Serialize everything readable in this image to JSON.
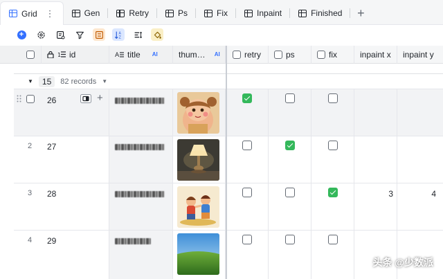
{
  "tabs": [
    {
      "label": "Grid",
      "active": true,
      "close": "⋮"
    },
    {
      "label": "Gen"
    },
    {
      "label": "Retry"
    },
    {
      "label": "Ps"
    },
    {
      "label": "Fix"
    },
    {
      "label": "Inpaint"
    },
    {
      "label": "Finished"
    }
  ],
  "tab_add": "+",
  "toolbar": {
    "icons": [
      "plus-circle-icon",
      "gear-icon",
      "form-icon",
      "filter-icon",
      "group-icon",
      "sort-icon",
      "row-height-icon",
      "fill-color-icon"
    ]
  },
  "columns": {
    "id": "id",
    "title": "title",
    "title_ai": "AI",
    "thumb": "thum…",
    "thumb_ai": "AI",
    "retry": "retry",
    "ps": "ps",
    "fix": "fix",
    "inpaint_x": "inpaint x",
    "inpaint_y": "inpaint y"
  },
  "group": {
    "value": "15",
    "count": "82 records"
  },
  "rows": [
    {
      "num": "",
      "id": "26",
      "retry": true,
      "ps": false,
      "fix": false,
      "inpaint_x": "",
      "inpaint_y": ""
    },
    {
      "num": "2",
      "id": "27",
      "retry": false,
      "ps": true,
      "fix": false,
      "inpaint_x": "",
      "inpaint_y": ""
    },
    {
      "num": "3",
      "id": "28",
      "retry": false,
      "ps": false,
      "fix": true,
      "inpaint_x": "3",
      "inpaint_y": "4"
    },
    {
      "num": "4",
      "id": "29",
      "retry": false,
      "ps": false,
      "fix": false,
      "inpaint_x": "",
      "inpaint_y": ""
    }
  ],
  "watermark": "头条 @少数派",
  "colors": {
    "accent": "#3370ff",
    "check_green": "#34b85b"
  }
}
